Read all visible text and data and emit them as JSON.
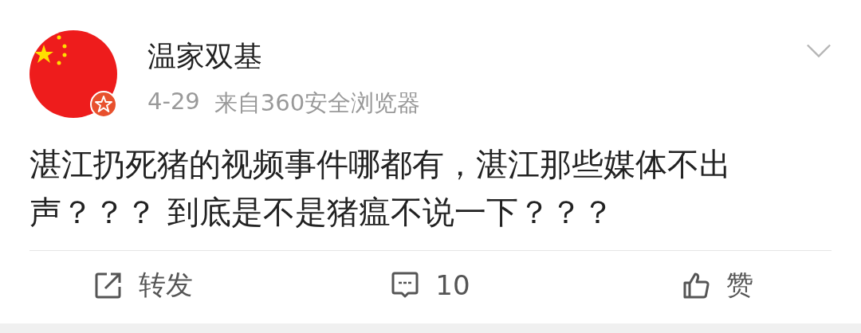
{
  "post": {
    "author": "温家双基",
    "date": "4-29",
    "source": "来自360安全浏览器",
    "text": "湛江扔死猪的视频事件哪都有，湛江那些媒体不出声？？？ 到底是不是猪瘟不说一下？？？"
  },
  "actions": [
    {
      "kind": "repost",
      "label": "转发"
    },
    {
      "kind": "comment",
      "label": "10"
    },
    {
      "kind": "like",
      "label": "赞"
    }
  ]
}
